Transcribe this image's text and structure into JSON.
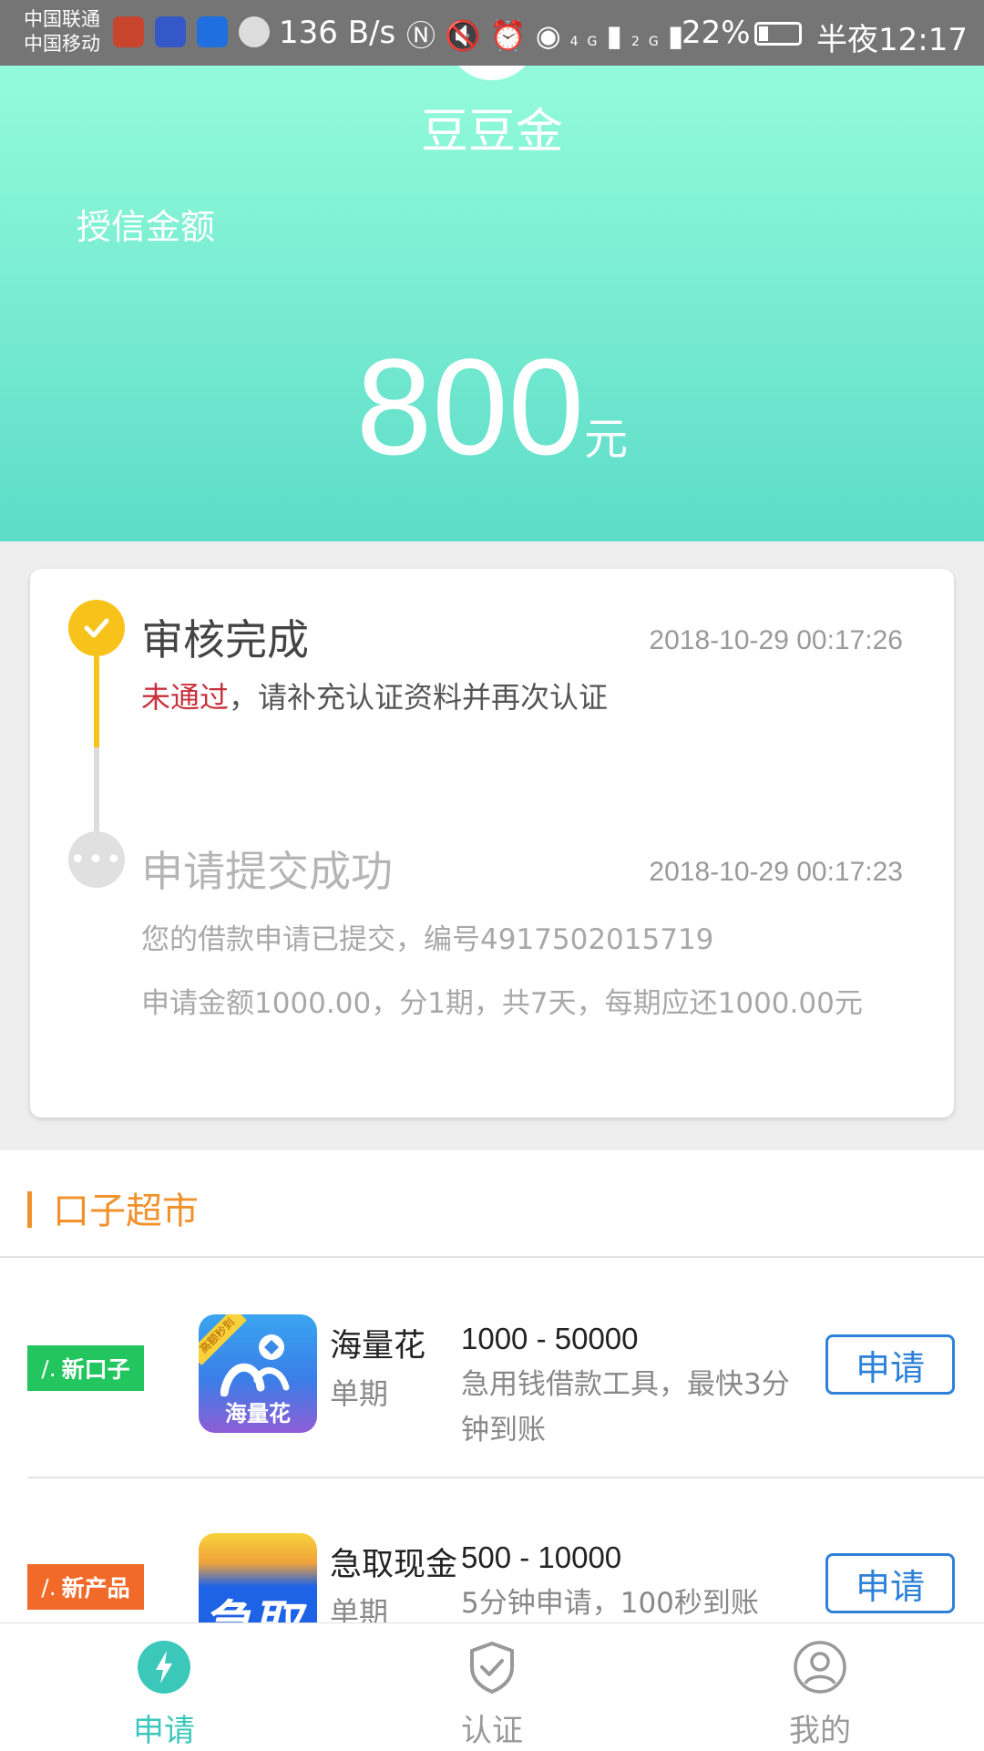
{
  "status_bar": {
    "carrier_1": "中国联通",
    "carrier_2": "中国移动",
    "net_speed": "136 B/s",
    "signal_4g": "4G",
    "signal_2g": "2G",
    "battery": "22%",
    "time": "半夜12:17"
  },
  "header": {
    "brand": "豆豆金",
    "credit_label": "授信金额",
    "amount": "800",
    "unit": "元",
    "gradient": [
      "#93fbdb",
      "#5ddcc8"
    ]
  },
  "timeline": [
    {
      "title": "审核完成",
      "time": "2018-10-29 00:17:26",
      "status": "未通过",
      "desc": "，请补充认证资料并再次认证",
      "icon": "check-icon",
      "color": "#f7c31b"
    },
    {
      "title": "申请提交成功",
      "time": "2018-10-29 00:17:23",
      "desc_line1": "您的借款申请已提交，编号4917502015719",
      "desc_line2": "申请金额1000.00，分1期，共7天，每期应还1000.00元",
      "icon": "more-dots-icon"
    }
  ],
  "market": {
    "title": "口子超市",
    "accent": "#f0912b",
    "products": [
      {
        "tag": "新口子",
        "tag_color": "#22c55e",
        "logo_text": "海量花",
        "logo_badge": "高额秒到",
        "name": "海量花",
        "term": "单期",
        "range": "1000 - 50000",
        "desc": "急用钱借款工具，最快3分钟到账",
        "button": "申请"
      },
      {
        "tag": "新产品",
        "tag_color": "#f26a2a",
        "logo_text": "急取",
        "name": "急取现金",
        "term": "单期",
        "range": "500 - 10000",
        "desc": "5分钟申请，100秒到账",
        "button": "申请"
      }
    ]
  },
  "bottom_nav": {
    "active_color": "#3cc7bb",
    "items": [
      {
        "label": "申请",
        "icon": "lightning-icon"
      },
      {
        "label": "认证",
        "icon": "shield-check-icon"
      },
      {
        "label": "我的",
        "icon": "user-icon"
      }
    ]
  }
}
